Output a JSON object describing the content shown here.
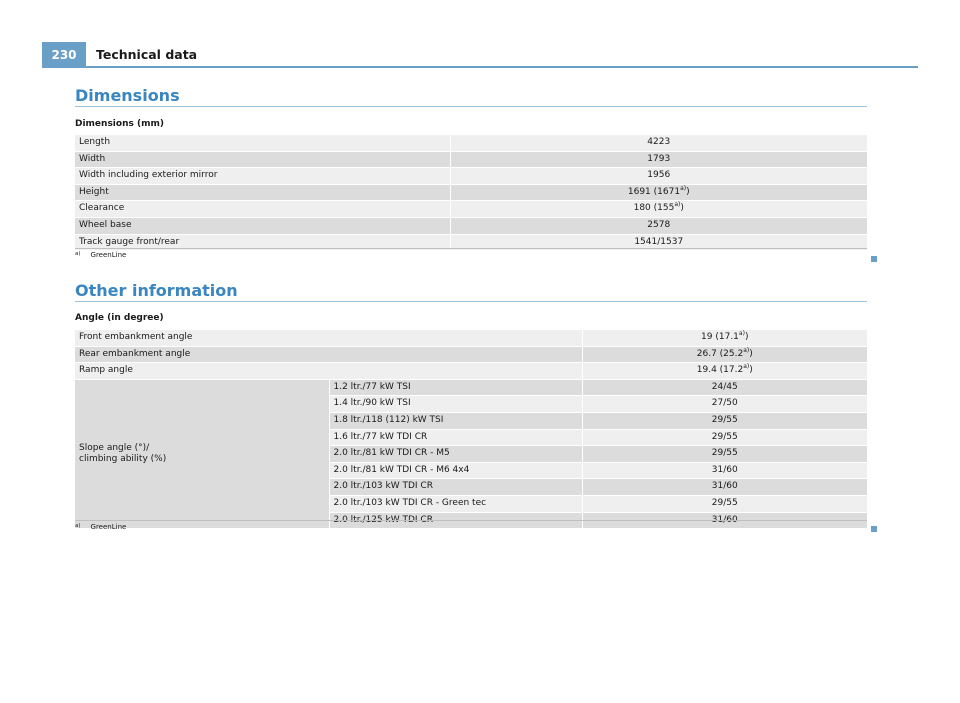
{
  "header": {
    "page_number": "230",
    "title": "Technical data"
  },
  "dimensions": {
    "section_title": "Dimensions",
    "table_title": "Dimensions (mm)",
    "rows": [
      {
        "label": "Length",
        "value": "4223",
        "ref": ""
      },
      {
        "label": "Width",
        "value": "1793",
        "ref": ""
      },
      {
        "label": "Width including exterior mirror",
        "value": "1956",
        "ref": ""
      },
      {
        "label": "Height",
        "value": "1691 (1671",
        "ref": "a)",
        "tail": ")"
      },
      {
        "label": "Clearance",
        "value": "180 (155",
        "ref": "a)",
        "tail": ")"
      },
      {
        "label": "Wheel base",
        "value": "2578",
        "ref": ""
      },
      {
        "label": "Track gauge front/rear",
        "value": "1541/1537",
        "ref": ""
      }
    ],
    "footnote": {
      "marker": "a)",
      "text": "GreenLine"
    }
  },
  "other": {
    "section_title": "Other information",
    "table_title": "Angle (in degree)",
    "rows": [
      {
        "label": "Front embankment angle",
        "value": "19 (17.1",
        "ref": "a)",
        "tail": ")"
      },
      {
        "label": "Rear embankment angle",
        "value": "26.7 (25.2",
        "ref": "a)",
        "tail": ")"
      },
      {
        "label": "Ramp angle",
        "value": "19.4 (17.2",
        "ref": "a)",
        "tail": ")"
      }
    ],
    "slope": {
      "label_line1": "Slope angle (°)/",
      "label_line2": "climbing ability (%)",
      "engines": [
        {
          "engine": "1.2 ltr./77 kW TSI",
          "value": "24/45"
        },
        {
          "engine": "1.4 ltr./90 kW TSI",
          "value": "27/50"
        },
        {
          "engine": "1.8 ltr./118 (112) kW TSI",
          "value": "29/55"
        },
        {
          "engine": "1.6 ltr./77 kW TDI CR",
          "value": "29/55"
        },
        {
          "engine": "2.0 ltr./81 kW TDI CR - M5",
          "value": "29/55"
        },
        {
          "engine": "2.0 ltr./81 kW TDI CR - M6 4x4",
          "value": "31/60"
        },
        {
          "engine": "2.0 ltr./103 kW TDI CR",
          "value": "31/60"
        },
        {
          "engine": "2.0 ltr./103 kW TDI CR - Green tec",
          "value": "29/55"
        },
        {
          "engine": "2.0 ltr./125 kW TDI CR",
          "value": "31/60"
        }
      ]
    },
    "footnote": {
      "marker": "a)",
      "text": "GreenLine"
    }
  },
  "colors": {
    "accent": "#6aa0c8",
    "section_title": "#3a86c0",
    "row_light": "#efefef",
    "row_dark": "#dcdcdc"
  }
}
